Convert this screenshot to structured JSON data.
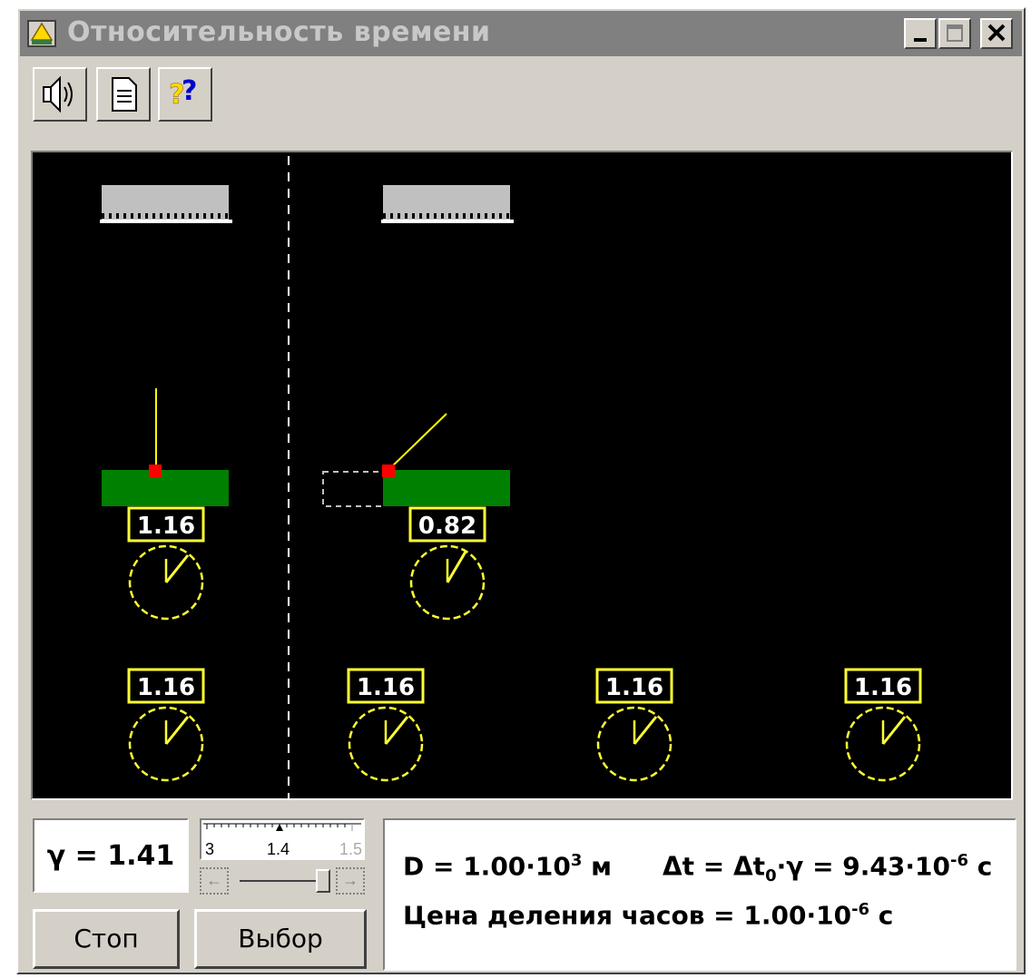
{
  "window": {
    "title": "Относительность времени",
    "controls": [
      "minimize-icon",
      "maximize-icon",
      "close-icon"
    ]
  },
  "toolbar": {
    "buttons": [
      {
        "name": "sound",
        "icon": "speaker-icon"
      },
      {
        "name": "document",
        "icon": "document-icon"
      },
      {
        "name": "help",
        "icon": "help-icon",
        "glyph": "??"
      }
    ]
  },
  "scene": {
    "colors": {
      "background": "#000000",
      "mirror": "#c0c0c0",
      "platform": "#008000",
      "photon": "#ff0000",
      "ray": "#ffff00",
      "clock": "#ffff33",
      "divider": "#ffffff"
    },
    "moving_clocks": [
      {
        "id": "rest",
        "reading": "1.16"
      },
      {
        "id": "moving",
        "reading": "0.82"
      }
    ],
    "ground_clocks": [
      {
        "reading": "1.16"
      },
      {
        "reading": "1.16"
      },
      {
        "reading": "1.16"
      },
      {
        "reading": "1.16"
      }
    ]
  },
  "controls": {
    "gamma_label": "γ = 1.41",
    "slider": {
      "tick_labels": [
        "3",
        "1.4",
        "1.5"
      ],
      "left_arrow": "←",
      "right_arrow": "→",
      "level": 0.88
    },
    "stop_button": "Стоп",
    "select_button": "Выбор"
  },
  "info": {
    "distance": {
      "prefix": "D = 1.00·10",
      "exp": "3",
      "unit": " м"
    },
    "delta_t": {
      "lhs": "Δt = Δt",
      "sub": "0",
      "mid": "·γ = 9.43·10",
      "exp": "-6",
      "unit": " с"
    },
    "division": {
      "prefix": "Цена деления часов = 1.00·10",
      "exp": "-6",
      "unit": " с"
    }
  }
}
